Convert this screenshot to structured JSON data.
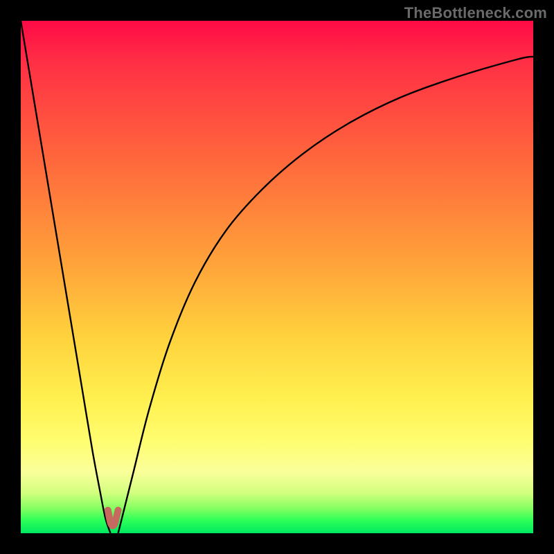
{
  "watermark": "TheBottleneck.com",
  "colors": {
    "frame": "#000000",
    "gradient_top": "#ff0a46",
    "gradient_mid": "#ffd33d",
    "gradient_bottom": "#00e860",
    "curve": "#000000",
    "nub": "#c66a5f"
  },
  "chart_data": {
    "type": "line",
    "title": "",
    "xlabel": "",
    "ylabel": "",
    "xlim": [
      0,
      100
    ],
    "ylim": [
      0,
      100
    ],
    "grid": false,
    "legend": false,
    "series": [
      {
        "name": "left-branch",
        "x": [
          0,
          2,
          4,
          6,
          8,
          10,
          12,
          14,
          15.5,
          16.5,
          17.5
        ],
        "y": [
          100,
          88,
          76,
          64,
          52,
          40,
          28,
          16,
          8,
          3,
          0
        ]
      },
      {
        "name": "right-branch",
        "x": [
          19,
          20,
          22,
          25,
          29,
          34,
          40,
          47,
          55,
          64,
          74,
          85,
          97,
          100
        ],
        "y": [
          0,
          4,
          12,
          24,
          37,
          49,
          59,
          67,
          74,
          80,
          85,
          89,
          92.5,
          93
        ]
      },
      {
        "name": "nub",
        "x": [
          17,
          17.6,
          18.3,
          19
        ],
        "y": [
          4.5,
          1.8,
          1.8,
          4.5
        ]
      }
    ],
    "annotations": []
  }
}
